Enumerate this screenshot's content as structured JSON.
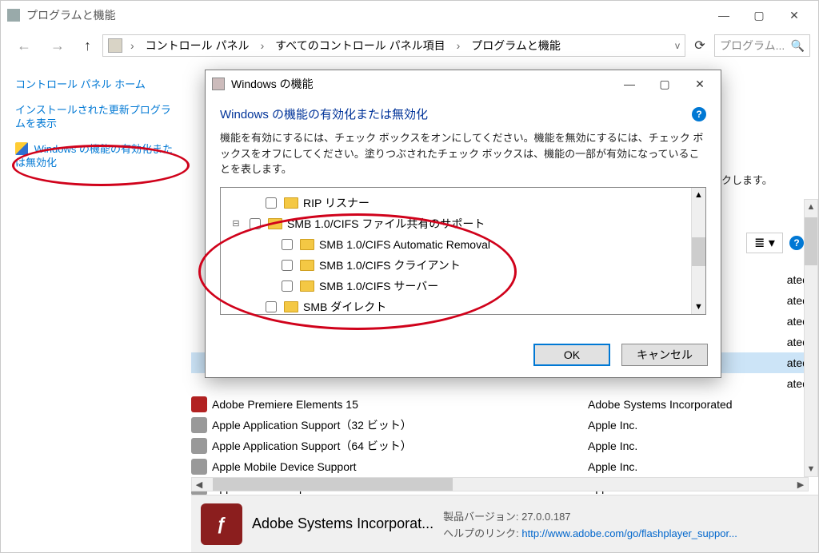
{
  "window": {
    "title": "プログラムと機能",
    "minimize": "—",
    "restore": "▢",
    "close": "✕"
  },
  "nav": {
    "back": "←",
    "forward": "→",
    "up": "↑",
    "breadcrumb": [
      "コントロール パネル",
      "すべてのコントロール パネル項目",
      "プログラムと機能"
    ],
    "sep": "›",
    "dropdown": "v",
    "refresh": "⟳",
    "search_placeholder": "プログラム..."
  },
  "sidebar": {
    "home_link": "コントロール パネル ホーム",
    "updates_link": "インストールされた更新プログラムを表示",
    "features_link": "Windows の機能の有効化または無効化"
  },
  "main": {
    "partial_text": "ックします。",
    "publisher_trunc": "ated"
  },
  "view_tools": {
    "help": "?"
  },
  "dialog": {
    "title": "Windows の機能",
    "heading": "Windows の機能の有効化または無効化",
    "desc": "機能を有効にするには、チェック ボックスをオンにしてください。機能を無効にするには、チェック ボックスをオフにしてください。塗りつぶされたチェック ボックスは、機能の一部が有効になっていることを表します。",
    "tree": [
      {
        "indent": 1,
        "expander": "",
        "label": "RIP リスナー"
      },
      {
        "indent": 1,
        "expander": "⊟",
        "label": "SMB 1.0/CIFS ファイル共有のサポート"
      },
      {
        "indent": 2,
        "expander": "",
        "label": "SMB 1.0/CIFS Automatic Removal"
      },
      {
        "indent": 2,
        "expander": "",
        "label": "SMB 1.0/CIFS クライアント"
      },
      {
        "indent": 2,
        "expander": "",
        "label": "SMB 1.0/CIFS サーバー"
      },
      {
        "indent": 1,
        "expander": "",
        "label": "SMB ダイレクト"
      }
    ],
    "ok": "OK",
    "cancel": "キャンセル",
    "minimize": "—",
    "restore": "▢",
    "close": "✕",
    "help": "?"
  },
  "programs": [
    {
      "name": "Adobe Premiere Elements 15",
      "publisher": "Adobe Systems Incorporated",
      "sel": false,
      "ico": "f"
    },
    {
      "name": "Apple Application Support（32 ビット）",
      "publisher": "Apple Inc.",
      "sel": false,
      "ico": "a"
    },
    {
      "name": "Apple Application Support（64 ビット）",
      "publisher": "Apple Inc.",
      "sel": false,
      "ico": "a"
    },
    {
      "name": "Apple Mobile Device Support",
      "publisher": "Apple Inc.",
      "sel": false,
      "ico": "a"
    },
    {
      "name": "Apple Software Update",
      "publisher": "Apple Inc.",
      "sel": false,
      "ico": "a"
    }
  ],
  "status": {
    "title": "Adobe Systems Incorporat...",
    "version_label": "製品バージョン:",
    "version_value": "27.0.0.187",
    "help_label": "ヘルプのリンク:",
    "help_value": "http://www.adobe.com/go/flashplayer_suppor..."
  }
}
